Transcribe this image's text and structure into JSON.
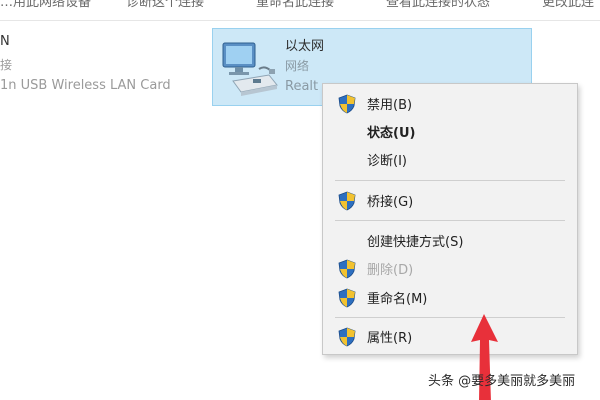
{
  "toolbar": {
    "items": [
      "…用此网络设备",
      "诊断这个连接",
      "重命名此连接",
      "查看此连接的状态",
      "更改此连"
    ]
  },
  "left_adapter": {
    "name": "N",
    "status": "接",
    "device": "1n USB Wireless LAN Card"
  },
  "selected_adapter": {
    "name": "以太网",
    "status": "网络",
    "device": "Realt"
  },
  "context_menu": {
    "items": [
      {
        "label": "禁用(B)",
        "shield": true,
        "bold": false,
        "disabled": false
      },
      {
        "label": "状态(U)",
        "shield": false,
        "bold": true,
        "disabled": false
      },
      {
        "label": "诊断(I)",
        "shield": false,
        "bold": false,
        "disabled": false
      },
      {
        "label": "桥接(G)",
        "shield": true,
        "bold": false,
        "disabled": false
      },
      {
        "label": "创建快捷方式(S)",
        "shield": false,
        "bold": false,
        "disabled": false
      },
      {
        "label": "删除(D)",
        "shield": true,
        "bold": false,
        "disabled": true
      },
      {
        "label": "重命名(M)",
        "shield": true,
        "bold": false,
        "disabled": false
      },
      {
        "label": "属性(R)",
        "shield": true,
        "bold": false,
        "disabled": false
      }
    ]
  },
  "icons": {
    "adapter": "network-adapter-icon",
    "shield": "uac-shield-icon",
    "arrow": "red-arrow-icon"
  },
  "colors": {
    "selection_bg": "#cde8f7",
    "selection_border": "#99d1ef",
    "menu_bg": "#f2f2f2",
    "arrow": "#e8303a"
  },
  "watermark": "头条 @要多美丽就多美丽"
}
